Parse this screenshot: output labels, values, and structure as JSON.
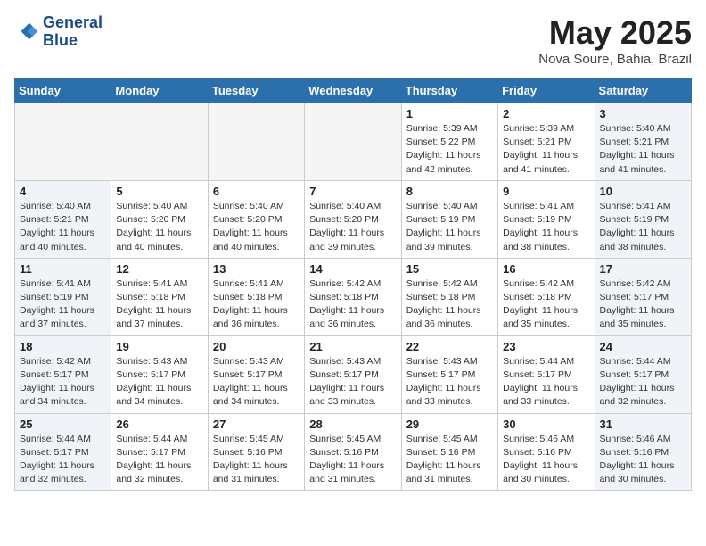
{
  "header": {
    "logo_line1": "General",
    "logo_line2": "Blue",
    "month": "May 2025",
    "location": "Nova Soure, Bahia, Brazil"
  },
  "weekdays": [
    "Sunday",
    "Monday",
    "Tuesday",
    "Wednesday",
    "Thursday",
    "Friday",
    "Saturday"
  ],
  "weeks": [
    [
      {
        "day": "",
        "info": ""
      },
      {
        "day": "",
        "info": ""
      },
      {
        "day": "",
        "info": ""
      },
      {
        "day": "",
        "info": ""
      },
      {
        "day": "1",
        "info": "Sunrise: 5:39 AM\nSunset: 5:22 PM\nDaylight: 11 hours\nand 42 minutes."
      },
      {
        "day": "2",
        "info": "Sunrise: 5:39 AM\nSunset: 5:21 PM\nDaylight: 11 hours\nand 41 minutes."
      },
      {
        "day": "3",
        "info": "Sunrise: 5:40 AM\nSunset: 5:21 PM\nDaylight: 11 hours\nand 41 minutes."
      }
    ],
    [
      {
        "day": "4",
        "info": "Sunrise: 5:40 AM\nSunset: 5:21 PM\nDaylight: 11 hours\nand 40 minutes."
      },
      {
        "day": "5",
        "info": "Sunrise: 5:40 AM\nSunset: 5:20 PM\nDaylight: 11 hours\nand 40 minutes."
      },
      {
        "day": "6",
        "info": "Sunrise: 5:40 AM\nSunset: 5:20 PM\nDaylight: 11 hours\nand 40 minutes."
      },
      {
        "day": "7",
        "info": "Sunrise: 5:40 AM\nSunset: 5:20 PM\nDaylight: 11 hours\nand 39 minutes."
      },
      {
        "day": "8",
        "info": "Sunrise: 5:40 AM\nSunset: 5:19 PM\nDaylight: 11 hours\nand 39 minutes."
      },
      {
        "day": "9",
        "info": "Sunrise: 5:41 AM\nSunset: 5:19 PM\nDaylight: 11 hours\nand 38 minutes."
      },
      {
        "day": "10",
        "info": "Sunrise: 5:41 AM\nSunset: 5:19 PM\nDaylight: 11 hours\nand 38 minutes."
      }
    ],
    [
      {
        "day": "11",
        "info": "Sunrise: 5:41 AM\nSunset: 5:19 PM\nDaylight: 11 hours\nand 37 minutes."
      },
      {
        "day": "12",
        "info": "Sunrise: 5:41 AM\nSunset: 5:18 PM\nDaylight: 11 hours\nand 37 minutes."
      },
      {
        "day": "13",
        "info": "Sunrise: 5:41 AM\nSunset: 5:18 PM\nDaylight: 11 hours\nand 36 minutes."
      },
      {
        "day": "14",
        "info": "Sunrise: 5:42 AM\nSunset: 5:18 PM\nDaylight: 11 hours\nand 36 minutes."
      },
      {
        "day": "15",
        "info": "Sunrise: 5:42 AM\nSunset: 5:18 PM\nDaylight: 11 hours\nand 36 minutes."
      },
      {
        "day": "16",
        "info": "Sunrise: 5:42 AM\nSunset: 5:18 PM\nDaylight: 11 hours\nand 35 minutes."
      },
      {
        "day": "17",
        "info": "Sunrise: 5:42 AM\nSunset: 5:17 PM\nDaylight: 11 hours\nand 35 minutes."
      }
    ],
    [
      {
        "day": "18",
        "info": "Sunrise: 5:42 AM\nSunset: 5:17 PM\nDaylight: 11 hours\nand 34 minutes."
      },
      {
        "day": "19",
        "info": "Sunrise: 5:43 AM\nSunset: 5:17 PM\nDaylight: 11 hours\nand 34 minutes."
      },
      {
        "day": "20",
        "info": "Sunrise: 5:43 AM\nSunset: 5:17 PM\nDaylight: 11 hours\nand 34 minutes."
      },
      {
        "day": "21",
        "info": "Sunrise: 5:43 AM\nSunset: 5:17 PM\nDaylight: 11 hours\nand 33 minutes."
      },
      {
        "day": "22",
        "info": "Sunrise: 5:43 AM\nSunset: 5:17 PM\nDaylight: 11 hours\nand 33 minutes."
      },
      {
        "day": "23",
        "info": "Sunrise: 5:44 AM\nSunset: 5:17 PM\nDaylight: 11 hours\nand 33 minutes."
      },
      {
        "day": "24",
        "info": "Sunrise: 5:44 AM\nSunset: 5:17 PM\nDaylight: 11 hours\nand 32 minutes."
      }
    ],
    [
      {
        "day": "25",
        "info": "Sunrise: 5:44 AM\nSunset: 5:17 PM\nDaylight: 11 hours\nand 32 minutes."
      },
      {
        "day": "26",
        "info": "Sunrise: 5:44 AM\nSunset: 5:17 PM\nDaylight: 11 hours\nand 32 minutes."
      },
      {
        "day": "27",
        "info": "Sunrise: 5:45 AM\nSunset: 5:16 PM\nDaylight: 11 hours\nand 31 minutes."
      },
      {
        "day": "28",
        "info": "Sunrise: 5:45 AM\nSunset: 5:16 PM\nDaylight: 11 hours\nand 31 minutes."
      },
      {
        "day": "29",
        "info": "Sunrise: 5:45 AM\nSunset: 5:16 PM\nDaylight: 11 hours\nand 31 minutes."
      },
      {
        "day": "30",
        "info": "Sunrise: 5:46 AM\nSunset: 5:16 PM\nDaylight: 11 hours\nand 30 minutes."
      },
      {
        "day": "31",
        "info": "Sunrise: 5:46 AM\nSunset: 5:16 PM\nDaylight: 11 hours\nand 30 minutes."
      }
    ]
  ]
}
